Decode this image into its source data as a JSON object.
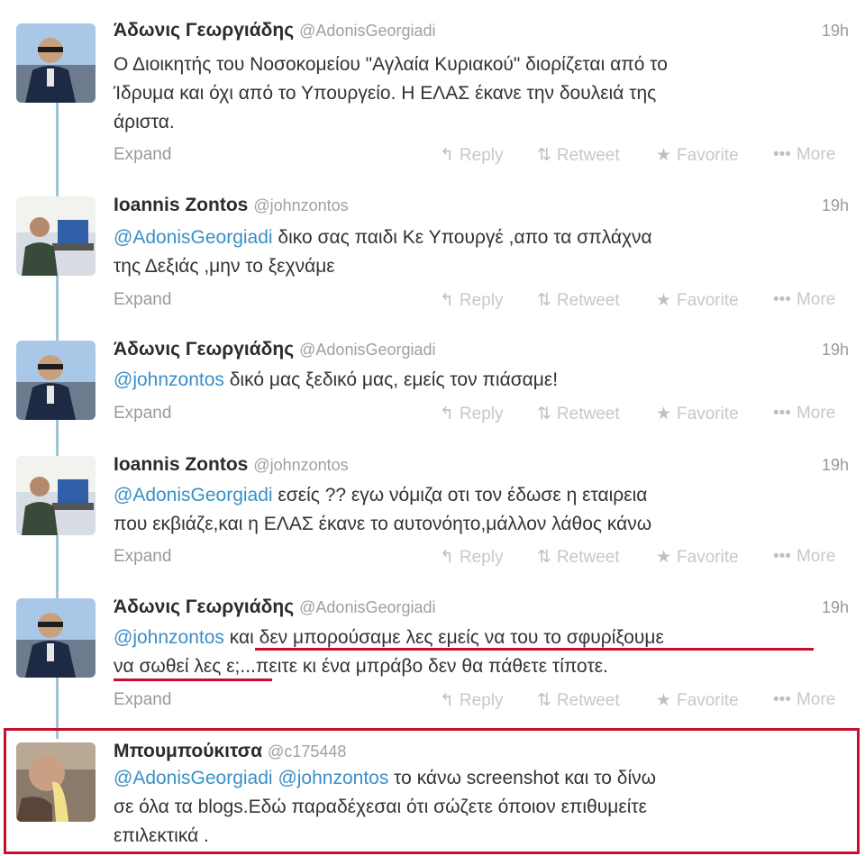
{
  "tweets": [
    {
      "name": "Άδωνις Γεωργιάδης",
      "handle": "@AdonisGeorgiadi",
      "time": "19h",
      "line1": "Ο Διοικητής του Νοσοκομείου \"Αγλαία Κυριακού\" διορίζεται από το",
      "line2": "Ίδρυμα και όχι από το Υπουργείο. Η ΕΛΑΣ έκανε την δουλειά της",
      "line3": "άριστα."
    },
    {
      "name": "Ioannis Zontos",
      "handle": "@johnzontos",
      "time": "19h",
      "mention": "@AdonisGeorgiadi",
      "line1_rest": " δικο σας παιδι Κε Υπουργέ ,απο τα σπλάχνα",
      "line2": "της Δεξιάς ,μην το ξεχνάμε"
    },
    {
      "name": "Άδωνις Γεωργιάδης",
      "handle": "@AdonisGeorgiadi",
      "time": "19h",
      "mention": "@johnzontos",
      "line1_rest": " δικό μας ξεδικό μας, εμείς τον πιάσαμε!"
    },
    {
      "name": "Ioannis Zontos",
      "handle": "@johnzontos",
      "time": "19h",
      "mention": "@AdonisGeorgiadi",
      "line1_rest": " εσείς ?? εγω νόμιζα οτι τον έδωσε η εταιρεια",
      "line2": "που εκβιάζε,και η ΕΛΑΣ έκανε το αυτονόητο,μάλλον λάθος κάνω"
    },
    {
      "name": "Άδωνις Γεωργιάδης",
      "handle": "@AdonisGeorgiadi",
      "time": "19h",
      "mention": "@johnzontos",
      "line1_rest": " και δεν μπορούσαμε λες εμείς να του το σφυρίξουμε",
      "line2": "να σωθεί λες ε;...πειτε κι ένα μπράβο δεν θα πάθετε τίποτε."
    },
    {
      "name": "Μπουμπούκιτσα",
      "handle": "@c175448",
      "mention1": "@AdonisGeorgiadi",
      "mention2": "@johnzontos",
      "line1_rest": " το κάνω screenshot και το δίνω",
      "line2": "σε όλα τα blogs.Εδώ παραδέχεσαι ότι  σώζετε όποιον επιθυμείτε",
      "line3": "επιλεκτικά ."
    }
  ],
  "actions": {
    "expand": "Expand",
    "reply": "Reply",
    "retweet": "Retweet",
    "favorite": "Favorite",
    "more": "More"
  },
  "icons": {
    "reply": "reply-arrow-icon",
    "retweet": "retweet-icon",
    "favorite": "star-icon",
    "more": "dots-icon"
  },
  "colors": {
    "mention": "#3a8fc7",
    "highlight": "#c8102e",
    "thread": "#9fc4d6"
  }
}
